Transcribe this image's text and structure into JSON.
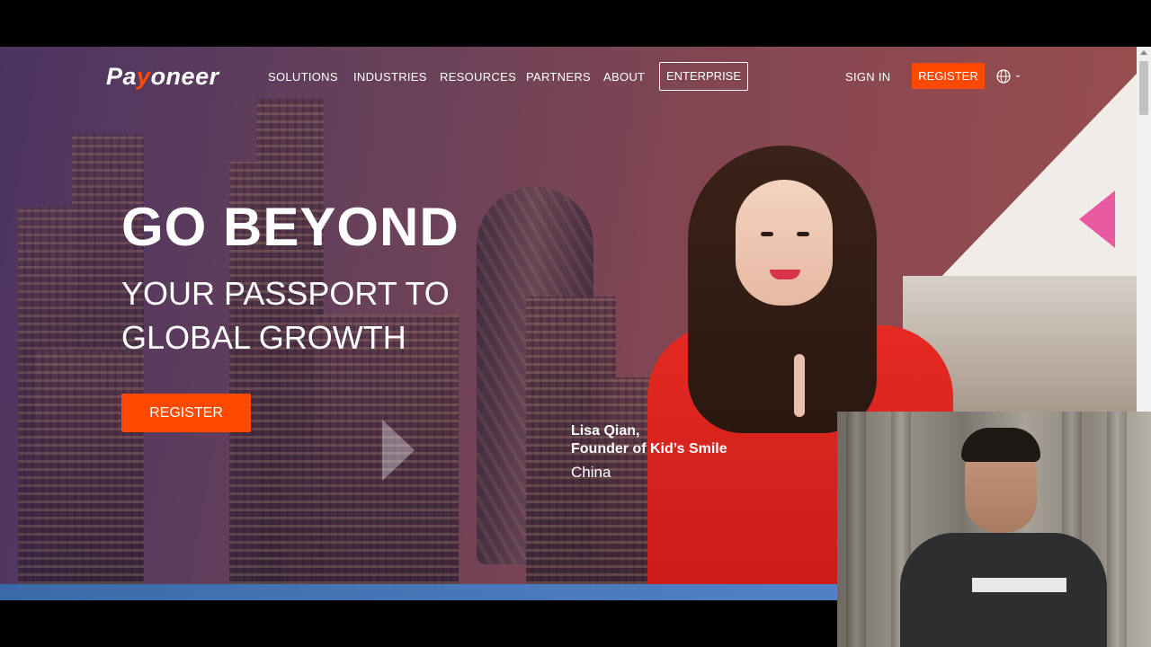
{
  "nav": {
    "logo_text_pre": "Pa",
    "logo_text_y": "y",
    "logo_text_post": "oneer",
    "items": [
      "SOLUTIONS",
      "INDUSTRIES",
      "RESOURCES",
      "PARTNERS",
      "ABOUT"
    ],
    "enterprise_label": "ENTERPRISE",
    "signin_label": "SIGN IN",
    "register_label": "REGISTER"
  },
  "hero": {
    "headline": "GO BEYOND",
    "subline_1": "YOUR PASSPORT TO",
    "subline_2": "GLOBAL GROWTH",
    "register_label": "REGISTER",
    "caption_name": "Lisa Qian,",
    "caption_role": "Founder of Kid’s Smile",
    "caption_country": "China"
  },
  "colors": {
    "accent": "#ff4800",
    "brand_text": "#ffffff"
  }
}
